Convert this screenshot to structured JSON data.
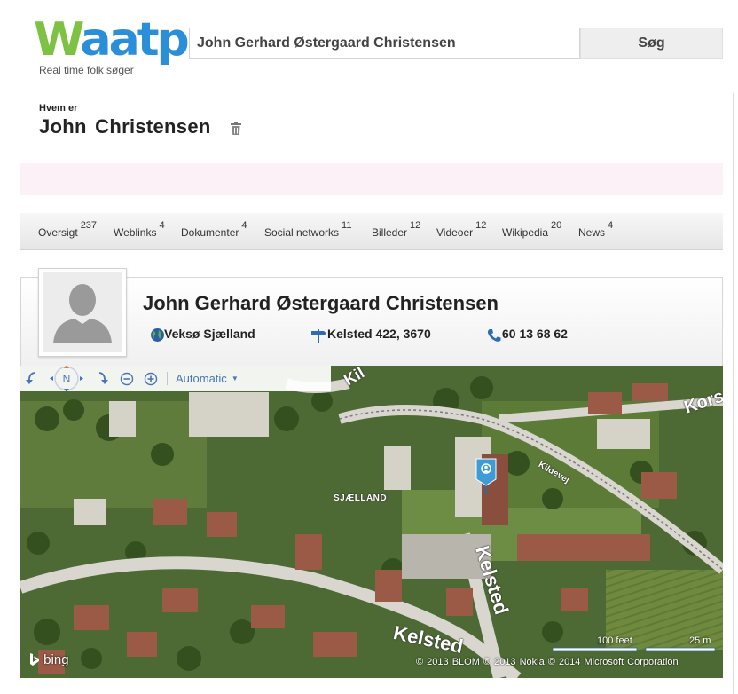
{
  "logo": {
    "w": "W",
    "rest": "aatp",
    "tagline": "Real time folk søger"
  },
  "search": {
    "value": "John Gerhard Østergaard Christensen",
    "button_label": "Søg"
  },
  "profile_header": {
    "eyebrow": "Hvem er",
    "name": "John Christensen"
  },
  "tabs": [
    {
      "label": "Oversigt",
      "count": "237"
    },
    {
      "label": "Weblinks",
      "count": "4"
    },
    {
      "label": "Dokumenter",
      "count": "4"
    },
    {
      "label": "Social networks",
      "count": "11"
    },
    {
      "label": "Billeder",
      "count": "12"
    },
    {
      "label": "Videoer",
      "count": "12"
    },
    {
      "label": "Wikipedia",
      "count": "20"
    },
    {
      "label": "News",
      "count": "4"
    }
  ],
  "card": {
    "full_name": "John Gerhard Østergaard Christensen",
    "city": "Veksø Sjælland",
    "address": "Kelsted 422, 3670",
    "phone": "60 13 68 62"
  },
  "map": {
    "compass_label": "N",
    "mode": "Automatic",
    "labels": {
      "road_kil": "Kil",
      "road_kors": "Kors",
      "road_kildevej": "Kildevej",
      "area": "SJÆLLAND",
      "road_kelsted_v": "Kelsted",
      "road_kelsted_h": "Kelsted"
    },
    "brand": "bing",
    "scale_feet": "100 feet",
    "scale_m": "25 m",
    "copyright": "© 2013 BLOM  © 2013 Nokia  © 2014 Microsoft Corporation"
  },
  "colors": {
    "logo_green": "#7dc242",
    "logo_blue": "#2a8fd8",
    "notice_pink": "#fdf1f8",
    "map_link": "#4a74b8",
    "pin_blue": "#3d9bd8"
  },
  "icons": {
    "trash": "trash-icon",
    "city": "globe-icon",
    "address": "signpost-icon",
    "phone": "phone-icon",
    "pin": "location-pin-icon"
  }
}
